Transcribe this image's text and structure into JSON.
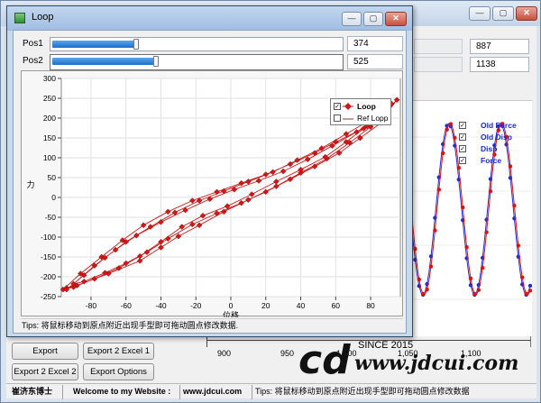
{
  "main_window": {
    "fields": {
      "top_value_a": "887",
      "top_value_b": "1138"
    },
    "bg_chart": {
      "legend": [
        {
          "label": "Old Force",
          "checked": true
        },
        {
          "label": "Old Disp",
          "checked": true
        },
        {
          "label": "Disp",
          "checked": true
        },
        {
          "label": "Force",
          "checked": true
        }
      ],
      "x_ticks": [
        "900",
        "950",
        "1,000",
        "1,050",
        "1,100"
      ],
      "colors": {
        "red": "#e01010",
        "blue": "#1f2fd0",
        "legend_text": "#1b2bd0"
      }
    },
    "buttons": {
      "export": "Export",
      "export_excel_1": "Export 2 Excel 1",
      "export_excel_2": "Export 2 Excel 2",
      "export_options": "Export Options"
    },
    "statusbar": {
      "author": "崔济东博士",
      "welcome": "Welcome to my Website :",
      "website": "www.jdcui.com",
      "tips": "Tips: 将鼠标移动到原点附近出现手型即可拖动圆点修改数据"
    },
    "watermark": {
      "since": "SINCE 2015",
      "url": "www.jdcui.com",
      "logo_letters": "cd"
    },
    "window_buttons": {
      "min": "—",
      "max": "▢",
      "close": "✕"
    }
  },
  "loop_dialog": {
    "title": "Loop",
    "pos1": {
      "label": "Pos1",
      "value": "374",
      "fraction": 0.29
    },
    "pos2": {
      "label": "Pos2",
      "value": "525",
      "fraction": 0.36
    },
    "tips": "Tips: 将鼠标移动到原点附近出现手型即可拖动圆点修改数据.",
    "window_buttons": {
      "min": "—",
      "max": "▢",
      "close": "✕"
    }
  },
  "chart_data": {
    "type": "scatter",
    "xlabel": "位移",
    "ylabel": "力",
    "xlim": [
      -97,
      97
    ],
    "ylim": [
      -250,
      300
    ],
    "x_ticks": [
      -80,
      -60,
      -40,
      -20,
      0,
      20,
      40,
      60,
      80
    ],
    "y_ticks": [
      -250,
      -200,
      -150,
      -100,
      -50,
      0,
      50,
      100,
      150,
      200,
      250,
      300
    ],
    "grid": true,
    "legend_position": "top-right",
    "series": [
      {
        "name": "Loop",
        "color": "#d01818",
        "x": [
          -94,
          -88,
          -70,
          -52,
          -40,
          -30,
          -18,
          -4,
          10,
          26,
          40,
          55,
          68,
          80,
          90,
          95,
          88,
          76,
          60,
          48,
          34,
          20,
          6,
          -8,
          -22,
          -36,
          -50,
          -62,
          -74,
          -86,
          -96,
          -90,
          -78,
          -64,
          -52,
          -40,
          -28,
          -16,
          -2,
          12,
          26,
          40,
          54,
          66,
          78,
          88,
          92,
          84,
          72,
          58,
          44,
          30,
          16,
          2,
          -12,
          -26,
          -40,
          -54,
          -66,
          -78,
          -90,
          -84,
          -72,
          -60,
          -48,
          -36,
          -22,
          -8,
          6,
          20,
          34,
          48,
          62,
          74,
          86,
          90,
          80,
          66,
          52,
          38,
          24,
          10,
          -4,
          -18,
          -32,
          -46,
          -60,
          -72,
          -84,
          -94
        ],
        "y": [
          -228,
          -222,
          -192,
          -160,
          -126,
          -98,
          -70,
          -36,
          -6,
          28,
          62,
          98,
          138,
          178,
          222,
          246,
          205,
          174,
          140,
          112,
          84,
          58,
          36,
          14,
          -8,
          -36,
          -70,
          -108,
          -150,
          -192,
          -232,
          -226,
          -205,
          -178,
          -148,
          -112,
          -74,
          -46,
          -22,
          8,
          40,
          70,
          102,
          140,
          180,
          216,
          236,
          200,
          165,
          130,
          96,
          66,
          42,
          20,
          -4,
          -32,
          -62,
          -96,
          -132,
          -172,
          -218,
          -212,
          -190,
          -166,
          -138,
          -104,
          -68,
          -40,
          -14,
          14,
          46,
          78,
          112,
          150,
          188,
          228,
          196,
          160,
          124,
          94,
          64,
          40,
          16,
          -8,
          -38,
          -74,
          -112,
          -152,
          -196,
          -232
        ]
      },
      {
        "name": "Ref Lopp",
        "color": "#8b3a3a",
        "x": [],
        "y": []
      }
    ]
  }
}
